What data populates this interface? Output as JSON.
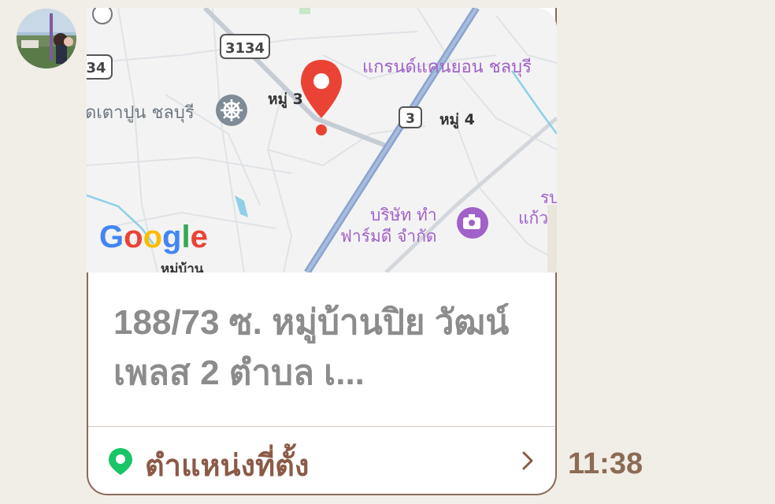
{
  "map": {
    "road_3134": "3134",
    "road_34": "34",
    "road_3": "3",
    "moo3": "หมู่ 3",
    "moo4": "หมู่ 4",
    "canyon": "แกรนด์แคนยอน ชลบุรี",
    "temple": "ัดเตาปูน ชลบุรี",
    "company_line1": "บริษัท ทำ",
    "company_line2": "ฟาร์มดี จำกัด",
    "kaew": "แก้ว",
    "ru": "รบ",
    "village": "หมู่บ้าน",
    "logo": "Google",
    "colors": {
      "pin": "#ea4335",
      "poi": "#a061c9",
      "highway": "#8aa4d0"
    }
  },
  "message": {
    "address": "188/73 ซ. หมู่บ้านปิย วัฒน์ เพลส 2 ตำบล เ...",
    "location_label": "ตำแหน่งที่ตั้ง",
    "time": "11:38"
  },
  "icons": {
    "location": "location-pin-icon",
    "chevron": "chevron-right-icon"
  }
}
